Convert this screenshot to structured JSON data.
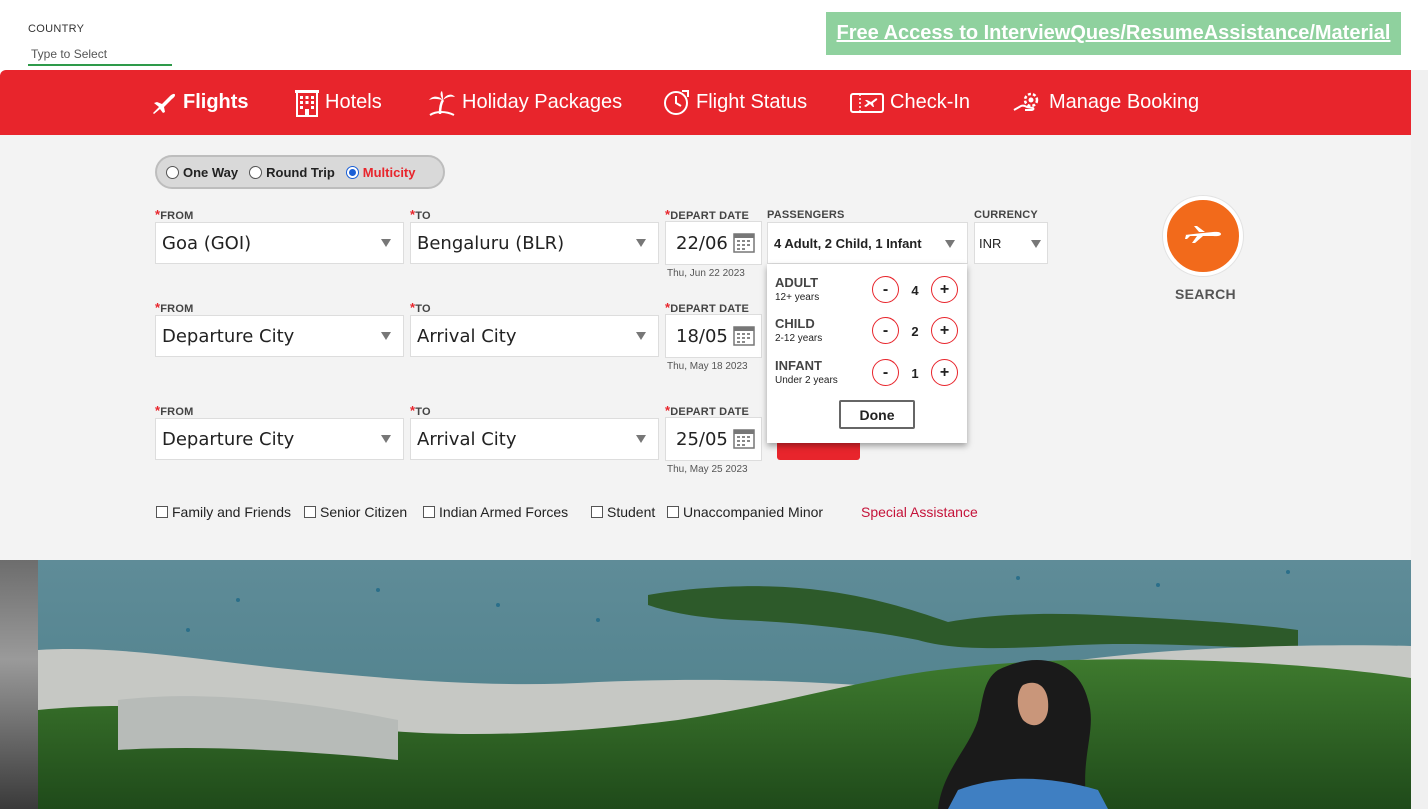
{
  "country": {
    "label": "COUNTRY",
    "placeholder": "Type to Select"
  },
  "promo": {
    "text": "Free Access to InterviewQues/ResumeAssistance/Material",
    "color": "#8fd19e"
  },
  "brand_color": "#e8252c",
  "nav": [
    {
      "label": "Flights",
      "icon": "plane-icon",
      "active": true
    },
    {
      "label": "Hotels",
      "icon": "hotel-icon"
    },
    {
      "label": "Holiday Packages",
      "icon": "palm-tree-icon"
    },
    {
      "label": "Flight Status",
      "icon": "clock-plane-icon"
    },
    {
      "label": "Check-In",
      "icon": "ticket-icon"
    },
    {
      "label": "Manage Booking",
      "icon": "gear-hand-icon"
    }
  ],
  "trip_types": [
    {
      "label": "One Way",
      "selected": false
    },
    {
      "label": "Round Trip",
      "selected": false
    },
    {
      "label": "Multicity",
      "selected": true
    }
  ],
  "labels": {
    "from": "FROM",
    "to": "TO",
    "depart_date": "DEPART DATE",
    "passengers": "PASSENGERS",
    "currency": "CURRENCY",
    "required": "*"
  },
  "legs": [
    {
      "from": "Goa (GOI)",
      "to": "Bengaluru (BLR)",
      "date": "22/06",
      "date_full": "Thu, Jun 22 2023"
    },
    {
      "from": "Departure City",
      "to": "Arrival City",
      "date": "18/05",
      "date_full": "Thu, May 18 2023"
    },
    {
      "from": "Departure City",
      "to": "Arrival City",
      "date": "25/05",
      "date_full": "Thu, May 25 2023"
    }
  ],
  "passengers": {
    "summary": "4 Adult, 2 Child, 1 Infant",
    "rows": [
      {
        "name": "ADULT",
        "sub": "12+ years",
        "count": "4"
      },
      {
        "name": "CHILD",
        "sub": "2-12 years",
        "count": "2"
      },
      {
        "name": "INFANT",
        "sub": "Under 2 years",
        "count": "1"
      }
    ],
    "minus": "-",
    "plus": "+",
    "done": "Done"
  },
  "currency": {
    "value": "INR"
  },
  "search": {
    "label": "SEARCH",
    "color": "#f26a1b"
  },
  "concessions": [
    {
      "label": "Family and Friends"
    },
    {
      "label": "Senior Citizen"
    },
    {
      "label": "Indian Armed Forces"
    },
    {
      "label": "Student"
    },
    {
      "label": "Unaccompanied Minor"
    }
  ],
  "special_assistance": "Special Assistance"
}
